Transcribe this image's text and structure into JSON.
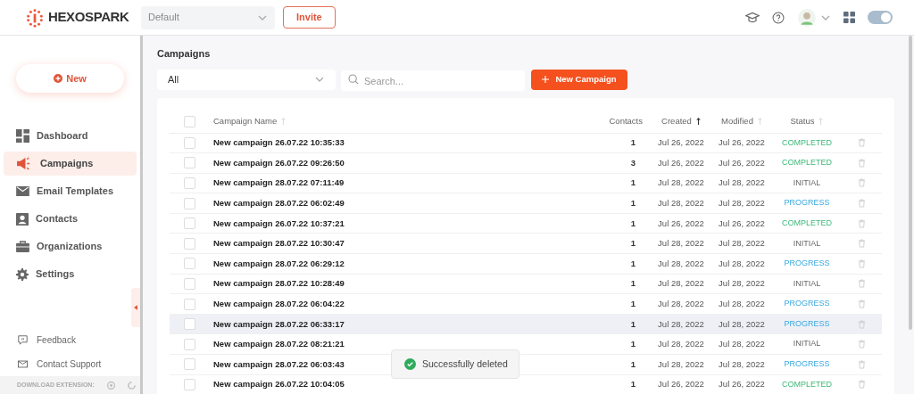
{
  "brand": "HEXOSPARK",
  "workspace": {
    "value": "Default"
  },
  "invite_button": "Invite",
  "toggle": {
    "on": true
  },
  "new_button": "New",
  "sidebar": {
    "items": [
      {
        "kind": "dashboard",
        "label": "Dashboard",
        "selected": false
      },
      {
        "kind": "campaigns",
        "label": "Campaigns",
        "selected": true
      },
      {
        "kind": "email",
        "label": "Email Templates",
        "selected": false
      },
      {
        "kind": "contacts",
        "label": "Contacts",
        "selected": false
      },
      {
        "kind": "organizations",
        "label": "Organizations",
        "selected": false
      },
      {
        "kind": "settings",
        "label": "Settings",
        "selected": false
      }
    ],
    "footer_links": [
      {
        "kind": "feedback",
        "label": "Feedback"
      },
      {
        "kind": "support",
        "label": "Contact Support"
      }
    ],
    "download_label": "DOWNLOAD EXTENSION:"
  },
  "page_title": "Campaigns",
  "filter": {
    "value": "All"
  },
  "search": {
    "placeholder": "Search..."
  },
  "new_campaign_button": "New Campaign",
  "table": {
    "select_all_checked": false,
    "columns": [
      {
        "label": "Campaign Name",
        "sorted": false
      },
      {
        "label": "Contacts"
      },
      {
        "label": "Created",
        "sorted": true
      },
      {
        "label": "Modified",
        "sorted": false
      },
      {
        "label": "Status",
        "sorted": false
      }
    ],
    "rows": [
      {
        "checked": false,
        "name": "New campaign 26.07.22 10:35:33",
        "contacts": "1",
        "created": "Jul 26, 2022",
        "modified": "Jul 26, 2022",
        "status": "COMPLETED",
        "kind": "completed",
        "hovered": false
      },
      {
        "checked": false,
        "name": "New campaign 26.07.22 09:26:50",
        "contacts": "3",
        "created": "Jul 26, 2022",
        "modified": "Jul 26, 2022",
        "status": "COMPLETED",
        "kind": "completed",
        "hovered": false
      },
      {
        "checked": false,
        "name": "New campaign 28.07.22 07:11:49",
        "contacts": "1",
        "created": "Jul 28, 2022",
        "modified": "Jul 28, 2022",
        "status": "INITIAL",
        "kind": "initial",
        "hovered": false
      },
      {
        "checked": false,
        "name": "New campaign 28.07.22 06:02:49",
        "contacts": "1",
        "created": "Jul 28, 2022",
        "modified": "Jul 28, 2022",
        "status": "PROGRESS",
        "kind": "progress",
        "hovered": false
      },
      {
        "checked": false,
        "name": "New campaign 26.07.22 10:37:21",
        "contacts": "1",
        "created": "Jul 26, 2022",
        "modified": "Jul 26, 2022",
        "status": "COMPLETED",
        "kind": "completed",
        "hovered": false
      },
      {
        "checked": false,
        "name": "New campaign 28.07.22 10:30:47",
        "contacts": "1",
        "created": "Jul 28, 2022",
        "modified": "Jul 28, 2022",
        "status": "INITIAL",
        "kind": "initial",
        "hovered": false
      },
      {
        "checked": false,
        "name": "New campaign 28.07.22 06:29:12",
        "contacts": "1",
        "created": "Jul 28, 2022",
        "modified": "Jul 28, 2022",
        "status": "PROGRESS",
        "kind": "progress",
        "hovered": false
      },
      {
        "checked": false,
        "name": "New campaign 28.07.22 10:28:49",
        "contacts": "1",
        "created": "Jul 28, 2022",
        "modified": "Jul 28, 2022",
        "status": "INITIAL",
        "kind": "initial",
        "hovered": false
      },
      {
        "checked": false,
        "name": "New campaign 28.07.22 06:04:22",
        "contacts": "1",
        "created": "Jul 28, 2022",
        "modified": "Jul 28, 2022",
        "status": "PROGRESS",
        "kind": "progress",
        "hovered": false
      },
      {
        "checked": false,
        "name": "New campaign 28.07.22 06:33:17",
        "contacts": "1",
        "created": "Jul 28, 2022",
        "modified": "Jul 28, 2022",
        "status": "PROGRESS",
        "kind": "progress",
        "hovered": true
      },
      {
        "checked": false,
        "name": "New campaign 28.07.22 08:21:21",
        "contacts": "1",
        "created": "Jul 28, 2022",
        "modified": "Jul 28, 2022",
        "status": "INITIAL",
        "kind": "initial",
        "hovered": false
      },
      {
        "checked": false,
        "name": "New campaign 28.07.22 06:03:43",
        "contacts": "1",
        "created": "Jul 28, 2022",
        "modified": "Jul 28, 2022",
        "status": "PROGRESS",
        "kind": "progress",
        "hovered": false
      },
      {
        "checked": false,
        "name": "New campaign 26.07.22 10:04:05",
        "contacts": "1",
        "created": "Jul 26, 2022",
        "modified": "Jul 26, 2022",
        "status": "COMPLETED",
        "kind": "completed",
        "hovered": false
      }
    ]
  },
  "toast": "Successfully deleted"
}
